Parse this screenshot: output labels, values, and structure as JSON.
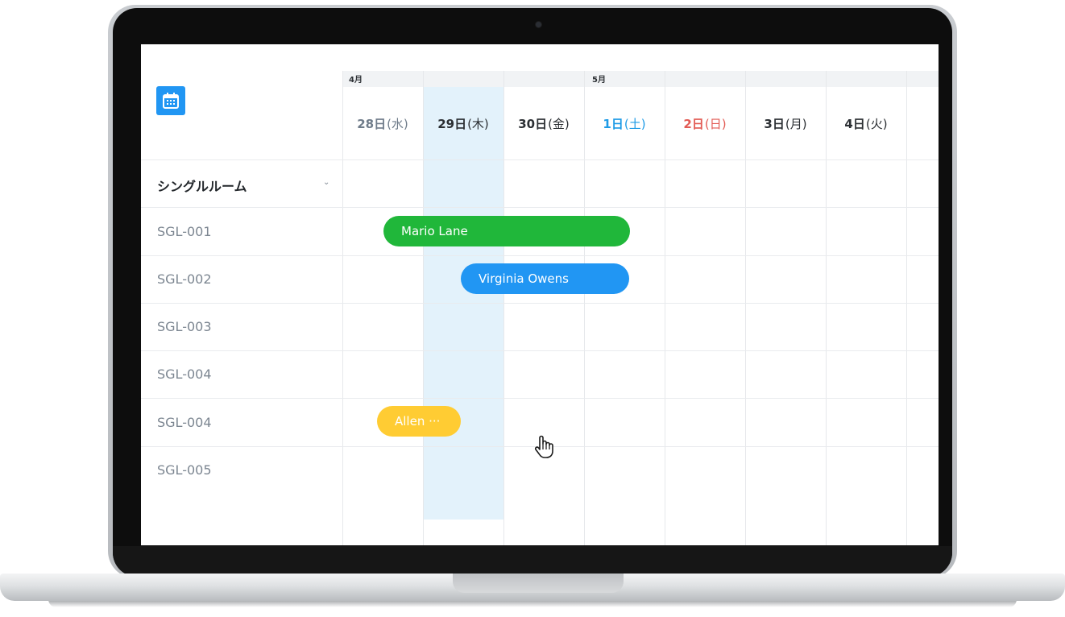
{
  "colors": {
    "accent": "#2196f3",
    "today_bg": "#e3f2fb",
    "saturday": "#1e9be6",
    "sunday": "#e25b54",
    "weekday": "#2b2f33",
    "past": "#6f7c8a"
  },
  "toolbar": {
    "calendar_icon": "calendar-icon"
  },
  "months": [
    "4月",
    "5月"
  ],
  "days": [
    {
      "num": "28日",
      "sfx": "(水)",
      "color": "#6f7c8a"
    },
    {
      "num": "29日",
      "sfx": "(木)",
      "color": "#2b2f33"
    },
    {
      "num": "30日",
      "sfx": "(金)",
      "color": "#2b2f33"
    },
    {
      "num": "1日",
      "sfx": "(土)",
      "color": "#1e9be6"
    },
    {
      "num": "2日",
      "sfx": "(日)",
      "color": "#e25b54"
    },
    {
      "num": "3日",
      "sfx": "(月)",
      "color": "#2b2f33"
    },
    {
      "num": "4日",
      "sfx": "(火)",
      "color": "#2b2f33"
    }
  ],
  "room_group": {
    "title": "シングルルーム",
    "toggle_icon": "chevron-down-icon",
    "toggle_glyph": "⌄"
  },
  "rooms": [
    "SGL-001",
    "SGL-002",
    "SGL-003",
    "SGL-004",
    "SGL-004",
    "SGL-005"
  ],
  "bookings": [
    {
      "guest": "Mario Lane",
      "color": "#20b73a",
      "room": "SGL-001"
    },
    {
      "guest": "Virginia Owens",
      "color": "#2196f3",
      "room": "SGL-002"
    },
    {
      "guest": "Allen ···",
      "color": "#ffcc33",
      "room": "SGL-004"
    }
  ]
}
